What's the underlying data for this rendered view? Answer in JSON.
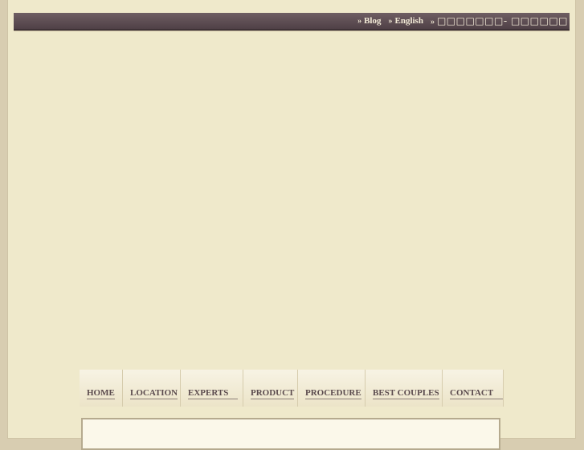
{
  "topbar": {
    "links": [
      {
        "arrow": "»",
        "label": "Blog"
      },
      {
        "arrow": "»",
        "label": "English"
      },
      {
        "arrow": "»",
        "label": "□□□□□□□- □□□□□□"
      }
    ]
  },
  "nav": {
    "items": [
      {
        "label": "HOME"
      },
      {
        "label": "LOCATION"
      },
      {
        "label": "EXPERTS"
      },
      {
        "label": "PRODUCT"
      },
      {
        "label": "PROCEDURE"
      },
      {
        "label": "BEST COUPLES"
      },
      {
        "label": "CONTACT"
      }
    ]
  },
  "colors": {
    "page_bg": "#efe9cb",
    "outer_bg": "#d8cdb1",
    "topbar": "#5a4a4f",
    "nav_text": "#5a4a4d"
  }
}
